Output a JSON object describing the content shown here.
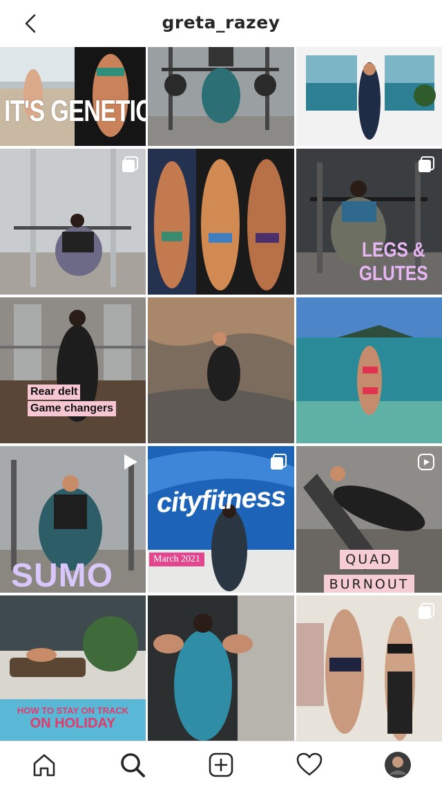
{
  "header": {
    "title": "greta_razey",
    "back_icon": "chevron-left-icon"
  },
  "grid": {
    "captions": {
      "genetics": "IT'S GENETICS",
      "legs_line1": "LEGS &",
      "legs_line2": "GLUTES",
      "rear_line1": "Rear delt",
      "rear_line2": "Game changers",
      "city_logo": "cityfitness",
      "march": "March 2021",
      "sumo": "SUMO",
      "quad_line1": "QUAD",
      "quad_line2": "BURNOUT",
      "holiday_line1": "HOW TO STAY ON TRACK",
      "holiday_line2": "ON HOLIDAY"
    },
    "badges": {
      "carousel": "carousel-icon",
      "video": "video-play-icon",
      "reel": "reel-icon"
    }
  },
  "bottom_nav": {
    "items": [
      "home-icon",
      "search-icon",
      "new-post-icon",
      "activity-heart-icon",
      "profile-avatar"
    ]
  },
  "colors": {
    "text": "#262626",
    "pink_caption": "#e23a6b",
    "lavender_caption": "#d9c7fb",
    "march_badge": "#e2468e"
  }
}
